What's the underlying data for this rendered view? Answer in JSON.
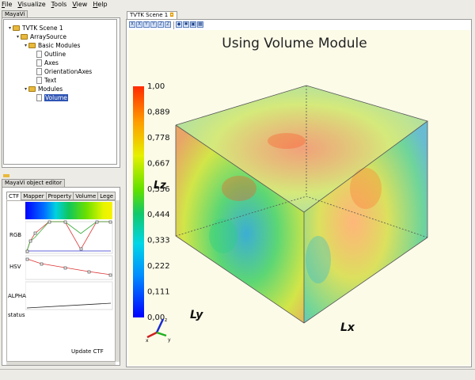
{
  "menu": [
    "File",
    "Visualize",
    "Tools",
    "View",
    "Help"
  ],
  "mayavi_tab": "MayaVi",
  "tree": [
    {
      "label": "TVTK Scene 1",
      "level": 0,
      "icon": "folder-icon",
      "expanded": true
    },
    {
      "label": "ArraySource",
      "level": 1,
      "icon": "folder-icon",
      "expanded": true
    },
    {
      "label": "Basic Modules",
      "level": 2,
      "icon": "folder-icon",
      "expanded": true
    },
    {
      "label": "Outline",
      "level": 3,
      "icon": "document-icon"
    },
    {
      "label": "Axes",
      "level": 3,
      "icon": "document-icon"
    },
    {
      "label": "OrientationAxes",
      "level": 3,
      "icon": "document-icon"
    },
    {
      "label": "Text",
      "level": 3,
      "icon": "document-icon"
    },
    {
      "label": "Modules",
      "level": 2,
      "icon": "folder-icon",
      "expanded": true
    },
    {
      "label": "Volume",
      "level": 3,
      "icon": "document-icon",
      "selected": true
    }
  ],
  "editor": {
    "title": "MayaVi object editor",
    "tabs": [
      "CTF",
      "Mapper",
      "Property",
      "Volume",
      "Lege"
    ],
    "active_tab": "CTF",
    "rows": {
      "rgb": "RGB",
      "hsv": "HSV",
      "alpha": "ALPHA",
      "status": "status"
    },
    "update_button": "Update CTF"
  },
  "scene": {
    "tab": "TVTK Scene 1",
    "title": "Using Volume Module",
    "colorbar_ticks": [
      "1,00",
      "0,889",
      "0,778",
      "0,667",
      "0,556",
      "0,444",
      "0,333",
      "0,222",
      "0,111",
      "0,00"
    ],
    "axis_labels": {
      "x": "Lx",
      "y": "Ly",
      "z": "Lz"
    },
    "orientation": {
      "x": "x",
      "y": "y",
      "z": "z"
    },
    "toolbar_icons": [
      "view-x-icon",
      "view-minus-x-icon",
      "view-y-icon",
      "view-minus-y-icon",
      "view-z-icon",
      "view-minus-z-icon",
      "separator",
      "isometric-icon",
      "parallel-projection-icon",
      "fullscreen-icon",
      "save-icon"
    ]
  },
  "colors": {
    "selection": "#2f54b3",
    "scene_bg": "#fcfbe8"
  }
}
